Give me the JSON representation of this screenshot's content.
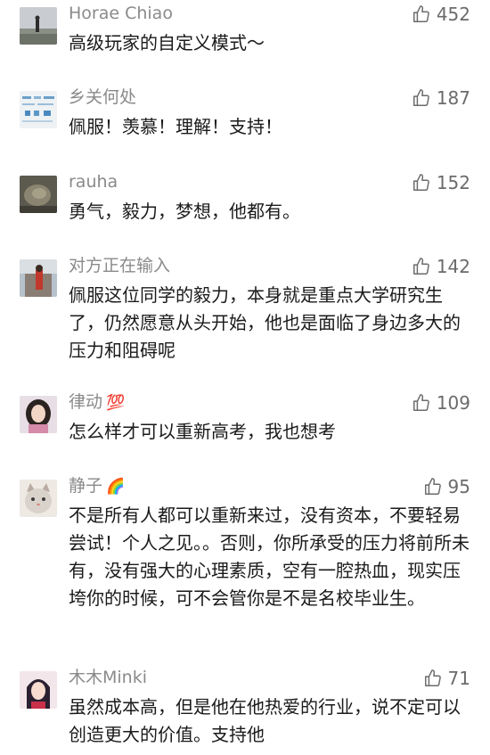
{
  "comments": [
    {
      "user": "Horae Chiao",
      "likes": "452",
      "text": "高级玩家的自定义模式～",
      "avatar": "landscape-avatar"
    },
    {
      "user": "乡关何处",
      "likes": "187",
      "text": "佩服！羡慕！理解！支持！",
      "avatar": "map-avatar"
    },
    {
      "user": "rauha",
      "likes": "152",
      "text": "勇气，毅力，梦想，他都有。",
      "avatar": "rock-avatar"
    },
    {
      "user": "对方正在输入",
      "likes": "142",
      "text": "佩服这位同学的毅力，本身就是重点大学研究生了，仍然愿意从头开始，他也是面临了身边多大的压力和阻碍呢",
      "avatar": "person-avatar"
    },
    {
      "user": "律动",
      "user_emoji": "💯",
      "likes": "109",
      "text": "怎么样才可以重新高考，我也想考",
      "avatar": "girl-avatar"
    },
    {
      "user": "静子",
      "user_emoji": "🌈",
      "likes": "95",
      "text": "不是所有人都可以重新来过，没有资本，不要轻易尝试！个人之见。。否则，你所承受的压力将前所未有，没有强大的心理素质，空有一腔热血，现实压垮你的时候，可不会管你是不是名校毕业生。",
      "avatar": "cat-avatar"
    },
    {
      "user": "木木Minki",
      "likes": "71",
      "text": "虽然成本高，但是他在他热爱的行业，说不定可以创造更大的价值。支持他",
      "avatar": "anime-girl-avatar"
    }
  ],
  "colors": {
    "username": "#8a8a8a",
    "likes": "#6b6b6b",
    "text": "#1a1a1a"
  },
  "icons": {
    "like": "thumbs-up-icon"
  }
}
